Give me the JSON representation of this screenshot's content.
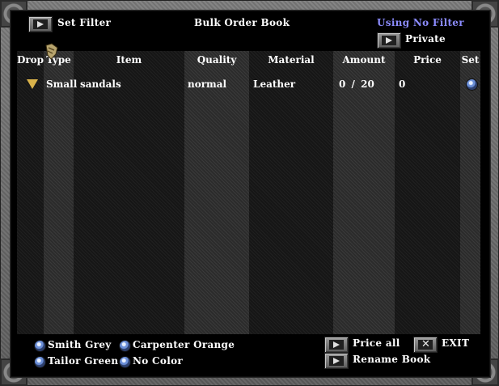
{
  "window": {
    "title": "Bulk Order Book"
  },
  "header": {
    "set_filter_label": "Set Filter",
    "filter_status": "Using No Filter",
    "private_label": "Private"
  },
  "columns": [
    "Drop",
    "Type",
    "Item",
    "Quality",
    "Material",
    "Amount",
    "Price",
    "Set"
  ],
  "rows": [
    {
      "type": "Small",
      "item": "sandals",
      "quality": "normal",
      "material": "Leather",
      "amount": "0 / 20",
      "price": "0"
    }
  ],
  "footer": {
    "filters": [
      "Smith Grey",
      "Carpenter Orange",
      "Tailor Green",
      "No Color"
    ],
    "price_all_label": "Price all",
    "rename_label": "Rename Book",
    "exit_label": "EXIT"
  },
  "colors": {
    "frame": "#6e6e6e",
    "filter_text": "#8c8cff",
    "drop_arrow": "#d9b24a"
  },
  "icons": {
    "drop": "triangle-down-icon",
    "set": "gem-icon",
    "buttons": "arrow-icon",
    "exit": "close-icon"
  }
}
